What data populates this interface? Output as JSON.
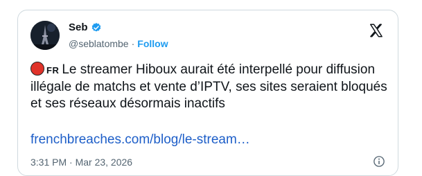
{
  "tweet": {
    "author_name": "Seb",
    "handle": "@seblatombe",
    "separator": "·",
    "follow_label": "Follow",
    "flag_code": "FR",
    "text": "Le streamer Hiboux aurait été interpellé pour diffusion illégale de matchs et vente d’IPTV, ses sites seraient bloqués et ses réseaux désormais inactifs",
    "link": "frenchbreaches.com/blog/le-stream…",
    "timestamp": "3:31 PM · Mar 23, 2026"
  },
  "icons": {
    "verified": "verified-badge-icon",
    "platform": "x-logo-icon",
    "info": "info-icon",
    "emoji": "red-circle-emoji"
  },
  "colors": {
    "accent": "#1d9bf0",
    "link": "#1d5ec8",
    "muted": "#536471",
    "border": "#cfd9de"
  }
}
